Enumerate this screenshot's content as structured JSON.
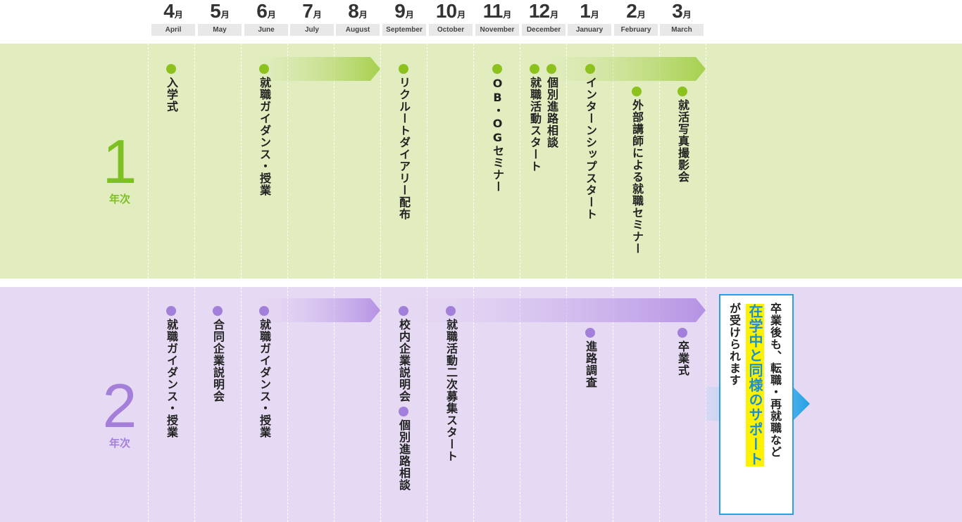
{
  "months": [
    {
      "num": "4",
      "unit": "月",
      "en": "April"
    },
    {
      "num": "5",
      "unit": "月",
      "en": "May"
    },
    {
      "num": "6",
      "unit": "月",
      "en": "June"
    },
    {
      "num": "7",
      "unit": "月",
      "en": "July"
    },
    {
      "num": "8",
      "unit": "月",
      "en": "August"
    },
    {
      "num": "9",
      "unit": "月",
      "en": "September"
    },
    {
      "num": "10",
      "unit": "月",
      "en": "October"
    },
    {
      "num": "11",
      "unit": "月",
      "en": "November"
    },
    {
      "num": "12",
      "unit": "月",
      "en": "December"
    },
    {
      "num": "1",
      "unit": "月",
      "en": "January"
    },
    {
      "num": "2",
      "unit": "月",
      "en": "February"
    },
    {
      "num": "3",
      "unit": "月",
      "en": "March"
    }
  ],
  "year1": {
    "num": "1",
    "label": "年次",
    "events": [
      "入学式",
      "就職ガイダンス・授業",
      "リクルートダイアリー配布",
      "OB・OGセミナー",
      "就職活動スタート",
      "個別進路相談",
      "インターンシップスタート",
      "外部講師による就職セミナー",
      "就活写真撮影会"
    ]
  },
  "year2": {
    "num": "2",
    "label": "年次",
    "events": [
      "就職ガイダンス・授業",
      "合同企業説明会",
      "就職ガイダンス・授業",
      "校内企業説明会",
      "個別進路相談",
      "就職活動二次募集スタート",
      "進路調査",
      "卒業式"
    ]
  },
  "callout": {
    "line1": "卒業後も、転職・再就職など",
    "highlight": "在学中と同様のサポート",
    "line3": "が受けられます"
  },
  "colors": {
    "green": "#8cc21e",
    "purple": "#a27fda",
    "blue": "#2c9fe0",
    "highlight": "#fff200"
  }
}
